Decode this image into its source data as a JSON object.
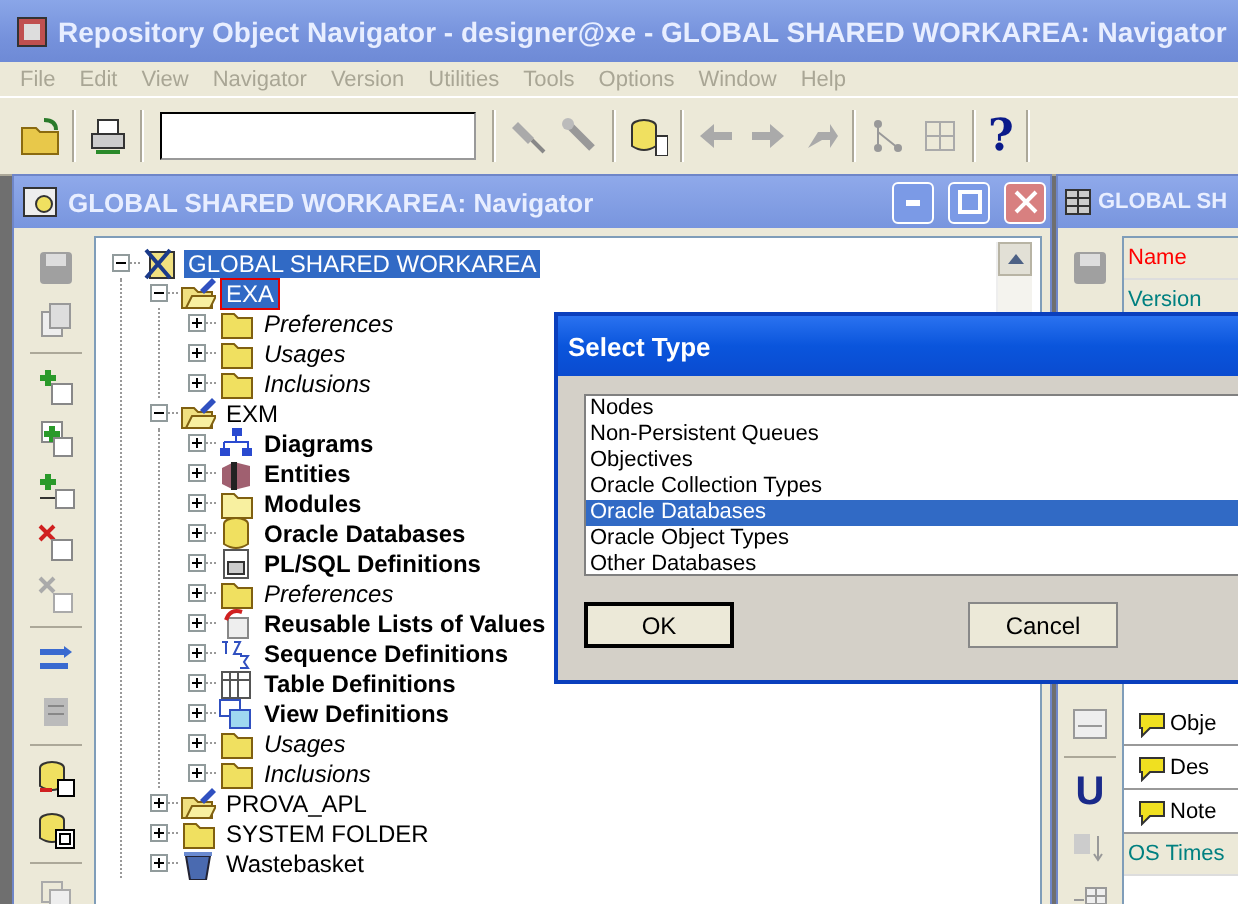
{
  "window": {
    "title": "Repository Object Navigator - designer@xe - GLOBAL SHARED WORKAREA: Navigator"
  },
  "menu": [
    "File",
    "Edit",
    "View",
    "Navigator",
    "Version",
    "Utilities",
    "Tools",
    "Options",
    "Window",
    "Help"
  ],
  "toolbar": {
    "help_glyph": "?"
  },
  "navigator": {
    "title": "GLOBAL SHARED WORKAREA: Navigator",
    "tree": [
      {
        "label": "GLOBAL SHARED WORKAREA",
        "kind": "workarea",
        "expanded": true,
        "selected": true,
        "focused": false,
        "children": [
          {
            "label": "EXA",
            "kind": "application",
            "expanded": true,
            "selected": true,
            "focused": true,
            "children": [
              {
                "label": "Preferences",
                "kind": "setting",
                "expanded": false,
                "selected": false,
                "focused": false
              },
              {
                "label": "Usages",
                "kind": "setting",
                "expanded": false,
                "selected": false,
                "focused": false
              },
              {
                "label": "Inclusions",
                "kind": "setting",
                "expanded": false,
                "selected": false,
                "focused": false
              }
            ]
          },
          {
            "label": "EXM",
            "kind": "application",
            "expanded": true,
            "selected": false,
            "focused": false,
            "children": [
              {
                "label": "Diagrams",
                "kind": "diagrams",
                "expanded": false,
                "selected": false,
                "focused": false
              },
              {
                "label": "Entities",
                "kind": "entities",
                "expanded": false,
                "selected": false,
                "focused": false
              },
              {
                "label": "Modules",
                "kind": "modules",
                "expanded": false,
                "selected": false,
                "focused": false
              },
              {
                "label": "Oracle Databases",
                "kind": "databases",
                "expanded": false,
                "selected": false,
                "focused": false
              },
              {
                "label": "PL/SQL Definitions",
                "kind": "plsql",
                "expanded": false,
                "selected": false,
                "focused": false
              },
              {
                "label": "Preferences",
                "kind": "setting",
                "expanded": false,
                "selected": false,
                "focused": false
              },
              {
                "label": "Reusable Lists of Values",
                "kind": "lov",
                "expanded": false,
                "selected": false,
                "focused": false
              },
              {
                "label": "Sequence Definitions",
                "kind": "sequences",
                "expanded": false,
                "selected": false,
                "focused": false
              },
              {
                "label": "Table Definitions",
                "kind": "tables",
                "expanded": false,
                "selected": false,
                "focused": false
              },
              {
                "label": "View Definitions",
                "kind": "views",
                "expanded": false,
                "selected": false,
                "focused": false
              },
              {
                "label": "Usages",
                "kind": "setting",
                "expanded": false,
                "selected": false,
                "focused": false
              },
              {
                "label": "Inclusions",
                "kind": "setting",
                "expanded": false,
                "selected": false,
                "focused": false
              }
            ]
          },
          {
            "label": "PROVA_APL",
            "kind": "application",
            "expanded": false,
            "selected": false,
            "focused": false
          },
          {
            "label": "SYSTEM FOLDER",
            "kind": "folder",
            "expanded": false,
            "selected": false,
            "focused": false
          },
          {
            "label": "Wastebasket",
            "kind": "wastebasket",
            "expanded": false,
            "selected": false,
            "focused": false
          }
        ]
      }
    ]
  },
  "property_window": {
    "title": "GLOBAL SH",
    "properties": [
      {
        "label": "Name",
        "color": "#ff0000"
      },
      {
        "label": "Version",
        "color": "#008080"
      }
    ],
    "notes": [
      "Obje",
      "Des",
      "Note"
    ],
    "footer_property": {
      "label": "OS Times",
      "color": "#008080"
    },
    "toolbar_letter": "U"
  },
  "dialog": {
    "title": "Select Type",
    "options": [
      {
        "label": "Nodes",
        "selected": false
      },
      {
        "label": "Non-Persistent Queues",
        "selected": false
      },
      {
        "label": "Objectives",
        "selected": false
      },
      {
        "label": "Oracle Collection Types",
        "selected": false
      },
      {
        "label": "Oracle Databases",
        "selected": true
      },
      {
        "label": "Oracle Object Types",
        "selected": false
      },
      {
        "label": "Other Databases",
        "selected": false
      }
    ],
    "buttons": [
      {
        "label": "OK",
        "default": true
      },
      {
        "label": "Cancel",
        "default": false
      }
    ]
  }
}
